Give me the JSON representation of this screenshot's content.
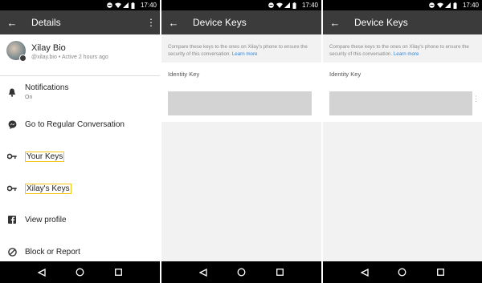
{
  "status": {
    "time": "17:40"
  },
  "panel1": {
    "title": "Details",
    "profile": {
      "name": "Xilay Bio",
      "subtitle": "@xilay.bio • Active 2 hours ago"
    },
    "menu": [
      {
        "label": "Notifications",
        "sub": "On",
        "icon": "bell-icon"
      },
      {
        "label": "Go to Regular Conversation",
        "icon": "messenger-icon"
      },
      {
        "label": "Your Keys",
        "icon": "key-icon",
        "highlighted": true
      },
      {
        "label": "Xilay's Keys",
        "icon": "key-icon",
        "highlighted": true
      },
      {
        "label": "View profile",
        "icon": "facebook-icon"
      },
      {
        "label": "Block or Report",
        "icon": "block-icon"
      }
    ]
  },
  "panel2": {
    "title": "Device Keys",
    "description": "Compare these keys to the ones on Xilay's phone to ensure the security of this conversation.",
    "learn_more": "Learn more",
    "identity_label": "Identity Key"
  },
  "panel3": {
    "title": "Device Keys",
    "description": "Compare these keys to the ones on Xilay's phone to ensure the security of this conversation.",
    "learn_more": "Learn more",
    "identity_label": "Identity Key"
  },
  "colors": {
    "appbar": "#3b3b3b",
    "highlight": "#f5c518",
    "link": "#2e86de"
  }
}
